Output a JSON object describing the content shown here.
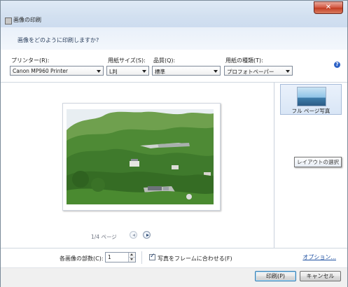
{
  "window": {
    "title": "画像の印刷",
    "close_label": "✕"
  },
  "header": {
    "question": "画像をどのように印刷しますか?"
  },
  "options": {
    "printer": {
      "label": "プリンター(R):",
      "value": "Canon MP960 Printer"
    },
    "paper_size": {
      "label": "用紙サイズ(S):",
      "value": "L判"
    },
    "quality": {
      "label": "品質(Q):",
      "value": "標準"
    },
    "paper_type": {
      "label": "用紙の種類(T):",
      "value": "プロフォトペーパー"
    },
    "help_label": "?"
  },
  "preview": {
    "page_indicator": "1/4 ページ"
  },
  "layout": {
    "selected_item_label": "フル ページ写真",
    "tooltip": "レイアウトの選択"
  },
  "bottom": {
    "copies_label": "各画像の部数(C):",
    "copies_value": "1",
    "fit_frame_label": "写真をフレームに合わせる(F)",
    "fit_frame_checked": true,
    "options_link": "オプション..."
  },
  "footer": {
    "print_label": "印刷(P)",
    "cancel_label": "キャンセル"
  }
}
